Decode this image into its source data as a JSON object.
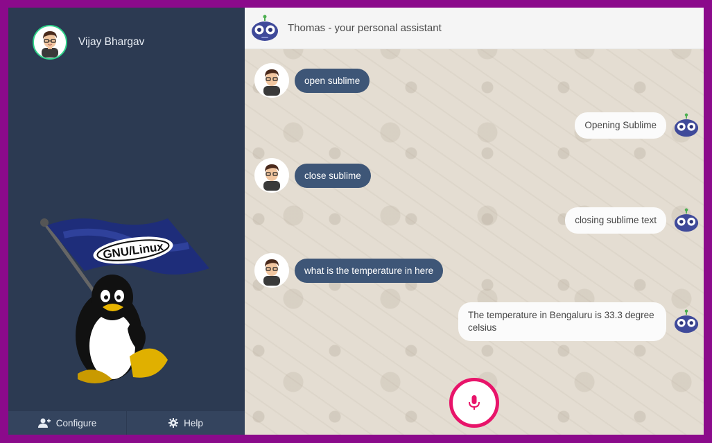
{
  "user": {
    "name": "Vijay Bhargav"
  },
  "sidebar": {
    "logo_text": "GNU/Linux",
    "footer": [
      {
        "label": "Configure",
        "icon": "add-user-icon"
      },
      {
        "label": "Help",
        "icon": "gear-icon"
      }
    ]
  },
  "chat": {
    "title": "Thomas - your personal assistant",
    "messages": [
      {
        "from": "user",
        "text": "open sublime"
      },
      {
        "from": "bot",
        "text": "Opening Sublime"
      },
      {
        "from": "user",
        "text": "close sublime"
      },
      {
        "from": "bot",
        "text": "closing sublime text"
      },
      {
        "from": "user",
        "text": "what is the temperature in here"
      },
      {
        "from": "bot",
        "text": "The temperature in Bengaluru is 33.3 degree celsius"
      }
    ]
  },
  "colors": {
    "outer_frame": "#8b0a8b",
    "sidebar": "#2c3a52",
    "user_bubble": "#3e5677",
    "bot_bubble": "#fbfbfb",
    "mic_accent": "#e8146a",
    "avatar_ring": "#2fd38a"
  }
}
